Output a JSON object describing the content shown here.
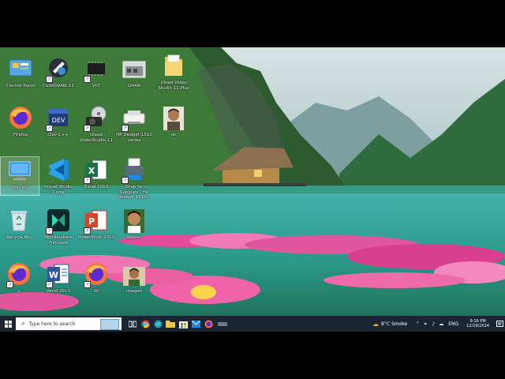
{
  "desktop": {
    "icons": [
      {
        "label": "Control Panel",
        "icon": "control-panel-icon"
      },
      {
        "label": "CorelDRAW 12",
        "icon": "coreldraw-icon"
      },
      {
        "label": "VIIT",
        "icon": "chip-icon"
      },
      {
        "label": "GHAR",
        "icon": "house-photo-icon"
      },
      {
        "label": "Ulead Video Studio 11 Plus",
        "icon": "folder-icon"
      },
      {
        "label": "Firefox",
        "icon": "firefox-icon"
      },
      {
        "label": "Dev-C++",
        "icon": "devcpp-icon"
      },
      {
        "label": "Ulead VideoStudio 11",
        "icon": "videostudio-icon"
      },
      {
        "label": "HP Deskjet 1510 series",
        "icon": "printer-icon"
      },
      {
        "label": "ok",
        "icon": "person-photo-icon"
      },
      {
        "label": "This PC",
        "icon": "this-pc-icon"
      },
      {
        "label": "Visual Studio Code",
        "icon": "vscode-icon"
      },
      {
        "label": "Excel 2013",
        "icon": "excel-icon"
      },
      {
        "label": "Shop for Supplies - HP Deskjet 1510...",
        "icon": "printer-shop-icon"
      },
      {
        "label": "Recycle Bin",
        "icon": "recycle-bin-icon"
      },
      {
        "label": "Wondershare Filmora9",
        "icon": "filmora-icon"
      },
      {
        "label": "PowerPoint 2013",
        "icon": "powerpoint-icon"
      },
      {
        "label": "Wasim",
        "icon": "person-photo-icon"
      },
      {
        "label": "c",
        "icon": "firefox-icon"
      },
      {
        "label": "Word 2013",
        "icon": "word-icon"
      },
      {
        "label": "SP",
        "icon": "firefox-icon"
      },
      {
        "label": "images",
        "icon": "person-photo-icon"
      }
    ]
  },
  "taskbar": {
    "search_placeholder": "Type here to search",
    "weather": "8°C Smoke",
    "language": "ENG",
    "time": "9:16 PM",
    "date": "12/19/2024",
    "pinned": [
      "task-view-icon",
      "chrome-icon",
      "edge-icon",
      "file-explorer-icon",
      "store-icon",
      "mail-icon",
      "firefox-icon",
      "app-icon"
    ]
  },
  "colors": {
    "taskbar_bg": "#1c2533",
    "accent": "#0078d4"
  }
}
